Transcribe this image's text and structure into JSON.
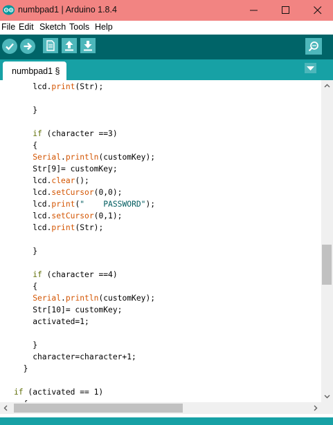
{
  "window": {
    "title": "numbpad1 | Arduino 1.8.4",
    "icons": {
      "app": "arduino-logo-icon",
      "minimize": "minimize-icon",
      "maximize": "maximize-icon",
      "close": "close-icon"
    }
  },
  "menu": {
    "items": [
      "File",
      "Edit",
      "Sketch",
      "Tools",
      "Help"
    ]
  },
  "toolbar": {
    "buttons": [
      "verify-icon",
      "upload-icon",
      "new-icon",
      "open-icon",
      "save-icon"
    ],
    "serial_monitor": "serial-monitor-icon"
  },
  "tabs": {
    "items": [
      "numbpad1 §"
    ],
    "menu_icon": "tab-menu-icon"
  },
  "colors": {
    "titlebar": "#f28482",
    "toolbar": "#006468",
    "tabbar": "#17a1a5",
    "button": "#4db7bb",
    "keyword": "#5e6d03",
    "function": "#d35400",
    "string": "#005c5f"
  },
  "editor": {
    "lines": [
      "    lcd.print(Str);",
      "",
      "    }",
      "",
      "    if (character ==3)",
      "    {",
      "    Serial.println(customKey);",
      "    Str[9]= customKey;",
      "    lcd.clear();",
      "    lcd.setCursor(0,0);",
      "    lcd.print(\"    PASSWORD\");",
      "    lcd.setCursor(0,1);",
      "    lcd.print(Str);",
      "",
      "    }",
      "",
      "    if (character ==4)",
      "    {",
      "    Serial.println(customKey);",
      "    Str[10]= customKey;",
      "    activated=1;",
      "",
      "    }",
      "    character=character+1;",
      "  }",
      "",
      "if (activated == 1)",
      "  {"
    ]
  }
}
